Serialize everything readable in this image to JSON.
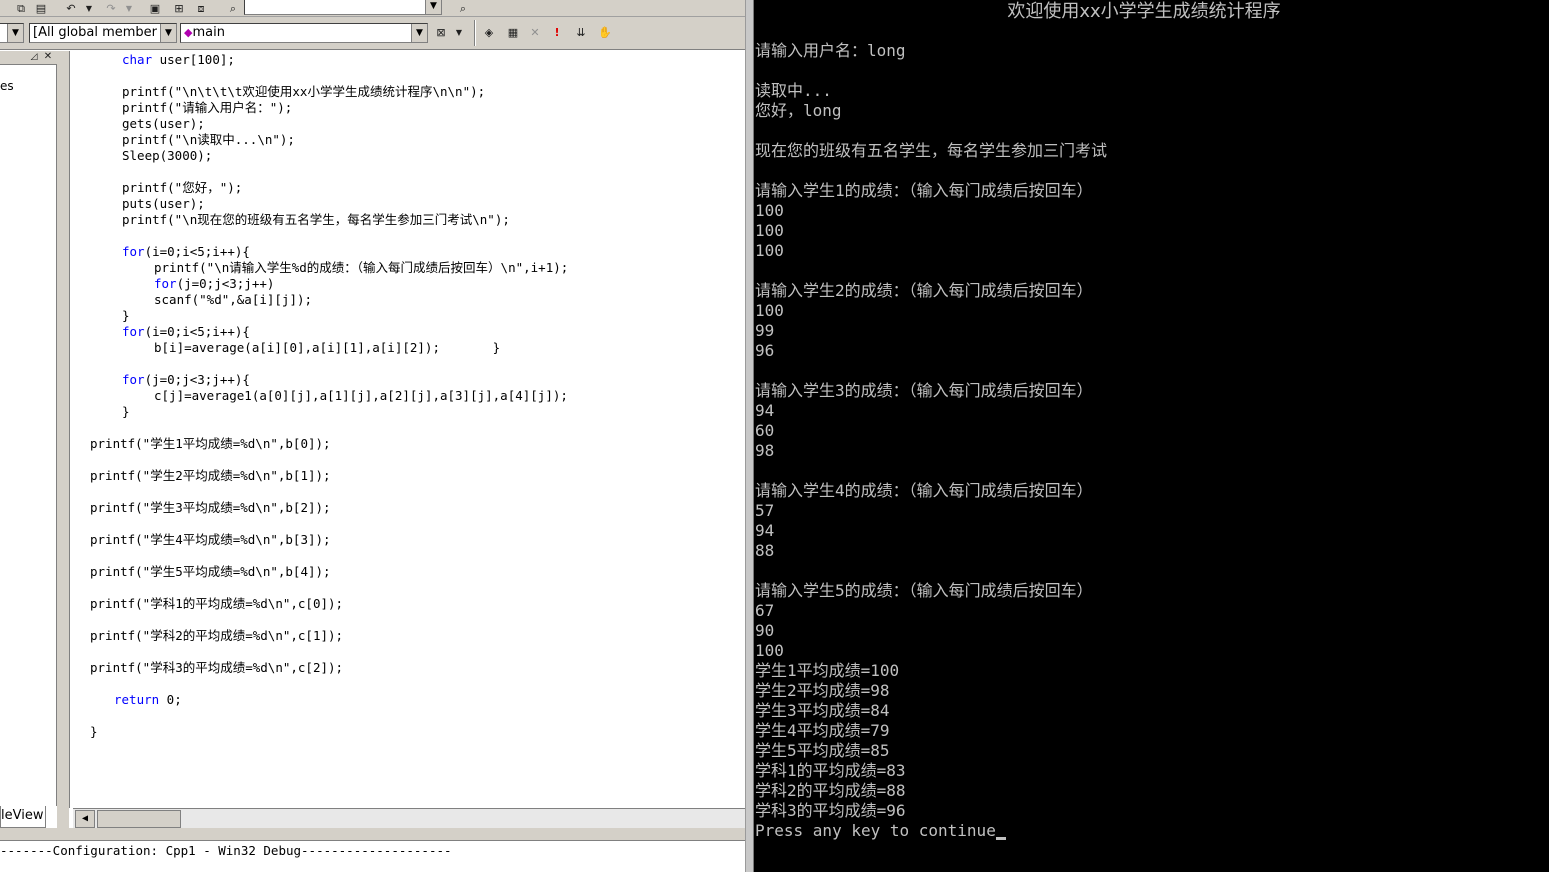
{
  "toolbar": {
    "scope_combo": "[All global member",
    "function_combo": "main"
  },
  "workspace": {
    "partial_label": "es",
    "tab_label": "leView"
  },
  "code_lines": [
    {
      "line": 0,
      "indent": 4,
      "kw": "char",
      "rest": " user[100];"
    },
    {
      "line": 2,
      "indent": 4,
      "kw": "",
      "rest": "printf(\"\\n\\t\\t\\t欢迎使用xx小学学生成绩统计程序\\n\\n\");"
    },
    {
      "line": 3,
      "indent": 4,
      "kw": "",
      "rest": "printf(\"请输入用户名：\");"
    },
    {
      "line": 4,
      "indent": 4,
      "kw": "",
      "rest": "gets(user);"
    },
    {
      "line": 5,
      "indent": 4,
      "kw": "",
      "rest": "printf(\"\\n读取中...\\n\");"
    },
    {
      "line": 6,
      "indent": 4,
      "kw": "",
      "rest": "Sleep(3000);"
    },
    {
      "line": 8,
      "indent": 4,
      "kw": "",
      "rest": "printf(\"您好，\");"
    },
    {
      "line": 9,
      "indent": 4,
      "kw": "",
      "rest": "puts(user);"
    },
    {
      "line": 10,
      "indent": 4,
      "kw": "",
      "rest": "printf(\"\\n现在您的班级有五名学生，每名学生参加三门考试\\n\");"
    },
    {
      "line": 12,
      "indent": 4,
      "kw": "for",
      "rest": "(i=0;i<5;i++){"
    },
    {
      "line": 13,
      "indent": 8,
      "kw": "",
      "rest": "printf(\"\\n请输入学生%d的成绩：（输入每门成绩后按回车）\\n\",i+1);"
    },
    {
      "line": 14,
      "indent": 8,
      "kw": "for",
      "rest": "(j=0;j<3;j++)"
    },
    {
      "line": 15,
      "indent": 8,
      "kw": "",
      "rest": "scanf(\"%d\",&a[i][j]);"
    },
    {
      "line": 16,
      "indent": 4,
      "kw": "",
      "rest": "}"
    },
    {
      "line": 17,
      "indent": 4,
      "kw": "for",
      "rest": "(i=0;i<5;i++){"
    },
    {
      "line": 18,
      "indent": 8,
      "kw": "",
      "rest": "b[i]=average(a[i][0],a[i][1],a[i][2]);       }"
    },
    {
      "line": 20,
      "indent": 4,
      "kw": "for",
      "rest": "(j=0;j<3;j++){"
    },
    {
      "line": 21,
      "indent": 8,
      "kw": "",
      "rest": "c[j]=average1(a[0][j],a[1][j],a[2][j],a[3][j],a[4][j]);"
    },
    {
      "line": 22,
      "indent": 4,
      "kw": "",
      "rest": "}"
    },
    {
      "line": 24,
      "indent": 0,
      "kw": "",
      "rest": "printf(\"学生1平均成绩=%d\\n\",b[0]);"
    },
    {
      "line": 26,
      "indent": 0,
      "kw": "",
      "rest": "printf(\"学生2平均成绩=%d\\n\",b[1]);"
    },
    {
      "line": 28,
      "indent": 0,
      "kw": "",
      "rest": "printf(\"学生3平均成绩=%d\\n\",b[2]);"
    },
    {
      "line": 30,
      "indent": 0,
      "kw": "",
      "rest": "printf(\"学生4平均成绩=%d\\n\",b[3]);"
    },
    {
      "line": 32,
      "indent": 0,
      "kw": "",
      "rest": "printf(\"学生5平均成绩=%d\\n\",b[4]);"
    },
    {
      "line": 34,
      "indent": 0,
      "kw": "",
      "rest": "printf(\"学科1的平均成绩=%d\\n\",c[0]);"
    },
    {
      "line": 36,
      "indent": 0,
      "kw": "",
      "rest": "printf(\"学科2的平均成绩=%d\\n\",c[1]);"
    },
    {
      "line": 38,
      "indent": 0,
      "kw": "",
      "rest": "printf(\"学科3的平均成绩=%d\\n\",c[2]);"
    },
    {
      "line": 40,
      "indent": 3,
      "kw": "return",
      "rest": " 0;"
    },
    {
      "line": 42,
      "indent": 0,
      "kw": "",
      "rest": "}"
    }
  ],
  "output_pane": {
    "build_line": "-------Configuration: Cpp1 - Win32 Debug--------------------"
  },
  "console": {
    "title": "欢迎使用xx小学学生成绩统计程序",
    "lines": [
      {
        "row": 2,
        "text": "请输入用户名：long"
      },
      {
        "row": 4,
        "text": "读取中..."
      },
      {
        "row": 5,
        "text": "您好，long"
      },
      {
        "row": 7,
        "text": "现在您的班级有五名学生，每名学生参加三门考试"
      },
      {
        "row": 9,
        "text": "请输入学生1的成绩：（输入每门成绩后按回车）"
      },
      {
        "row": 10,
        "text": "100"
      },
      {
        "row": 11,
        "text": "100"
      },
      {
        "row": 12,
        "text": "100"
      },
      {
        "row": 14,
        "text": "请输入学生2的成绩：（输入每门成绩后按回车）"
      },
      {
        "row": 15,
        "text": "100"
      },
      {
        "row": 16,
        "text": "99"
      },
      {
        "row": 17,
        "text": "96"
      },
      {
        "row": 19,
        "text": "请输入学生3的成绩：（输入每门成绩后按回车）"
      },
      {
        "row": 20,
        "text": "94"
      },
      {
        "row": 21,
        "text": "60"
      },
      {
        "row": 22,
        "text": "98"
      },
      {
        "row": 24,
        "text": "请输入学生4的成绩：（输入每门成绩后按回车）"
      },
      {
        "row": 25,
        "text": "57"
      },
      {
        "row": 26,
        "text": "94"
      },
      {
        "row": 27,
        "text": "88"
      },
      {
        "row": 29,
        "text": "请输入学生5的成绩：（输入每门成绩后按回车）"
      },
      {
        "row": 30,
        "text": "67"
      },
      {
        "row": 31,
        "text": "90"
      },
      {
        "row": 32,
        "text": "100"
      },
      {
        "row": 33,
        "text": "学生1平均成绩=100"
      },
      {
        "row": 34,
        "text": "学生2平均成绩=98"
      },
      {
        "row": 35,
        "text": "学生3平均成绩=84"
      },
      {
        "row": 36,
        "text": "学生4平均成绩=79"
      },
      {
        "row": 37,
        "text": "学生5平均成绩=85"
      },
      {
        "row": 38,
        "text": "学科1的平均成绩=83"
      },
      {
        "row": 39,
        "text": "学科2的平均成绩=88"
      },
      {
        "row": 40,
        "text": "学科3的平均成绩=96"
      },
      {
        "row": 41,
        "text": "Press any key to continue"
      }
    ]
  },
  "colors": {
    "keyword": "#0000ff",
    "console_bg": "#000000",
    "console_fg": "#c0c0c0",
    "chrome": "#d4d0c8"
  }
}
